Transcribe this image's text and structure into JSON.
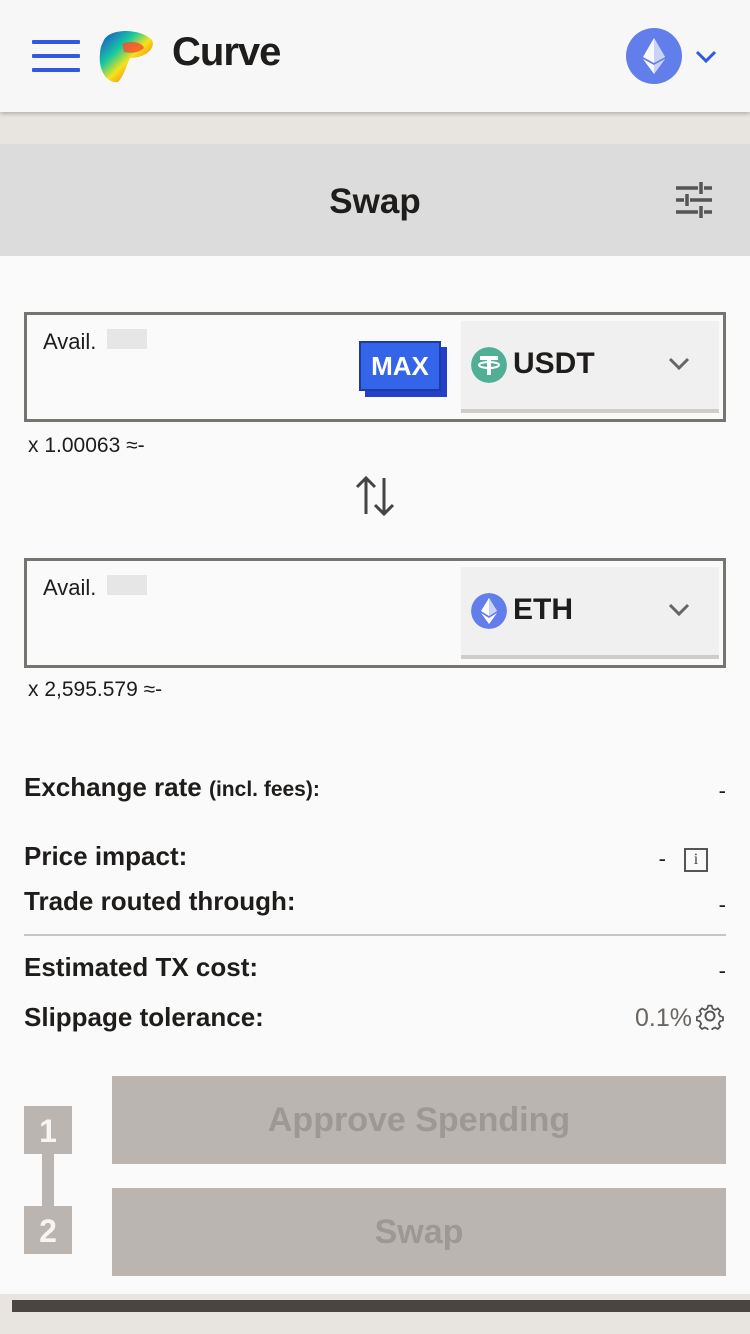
{
  "header": {
    "brand": "Curve",
    "network": "ethereum"
  },
  "swap": {
    "title": "Swap",
    "from": {
      "avail_label": "Avail.",
      "amount_placeholder": "",
      "max_label": "MAX",
      "token": "USDT",
      "rate_text": "x 1.00063 ≈-"
    },
    "to": {
      "avail_label": "Avail.",
      "amount_placeholder": "",
      "token": "ETH",
      "rate_text": "x 2,595.579 ≈-"
    },
    "details": {
      "exchange_rate_label": "Exchange rate",
      "exchange_rate_suffix": "(incl. fees):",
      "exchange_rate_value": "-",
      "price_impact_label": "Price impact:",
      "price_impact_value": "-",
      "routed_label": "Trade routed through:",
      "routed_value": "-",
      "tx_cost_label": "Estimated TX cost:",
      "tx_cost_value": "-",
      "slippage_label": "Slippage tolerance:",
      "slippage_value": "0.1%"
    },
    "steps": [
      {
        "num": "1",
        "label": "Approve Spending"
      },
      {
        "num": "2",
        "label": "Swap"
      }
    ]
  },
  "colors": {
    "accent": "#2f59e0",
    "max_button": "#3465e8",
    "usdt": "#50af95",
    "eth": "#627eea",
    "disabled": "#bab5b0"
  }
}
